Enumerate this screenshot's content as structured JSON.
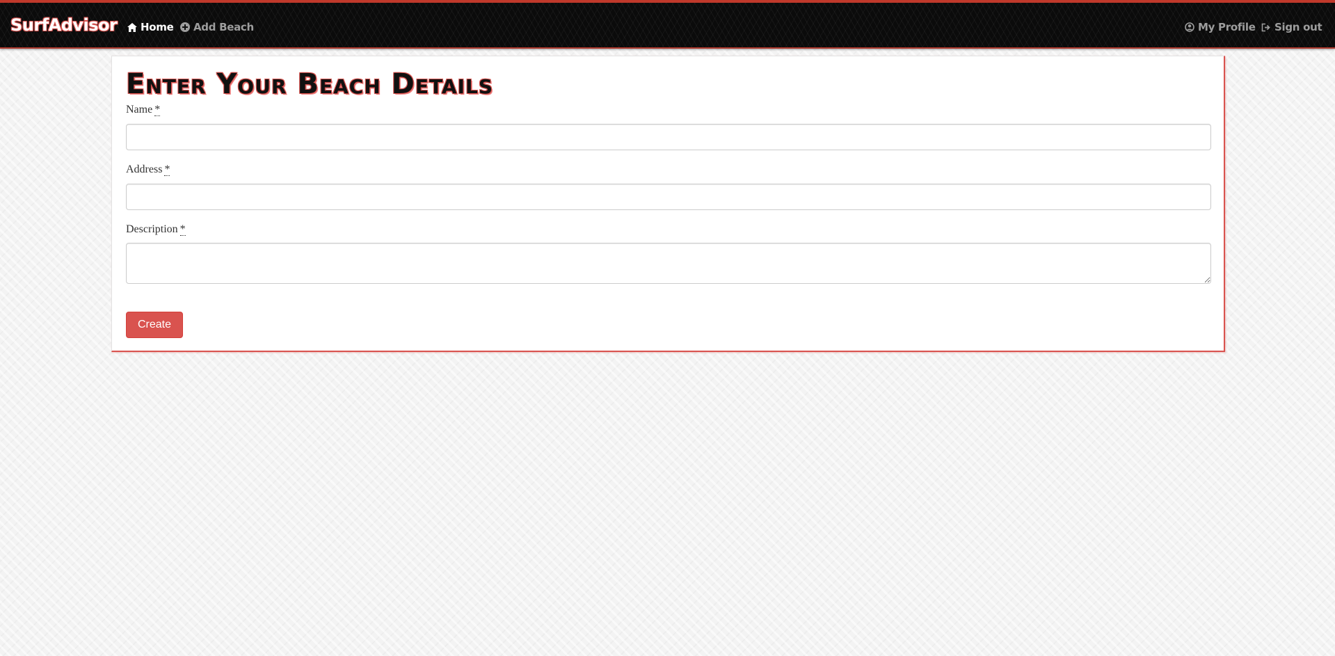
{
  "navbar": {
    "brand": "SurfAdvisor",
    "left_links": [
      {
        "label": "Home",
        "icon": "home-icon",
        "active": true
      },
      {
        "label": "Add Beach",
        "icon": "plus-circle-icon",
        "active": false
      }
    ],
    "right_links": [
      {
        "label": "My Profile",
        "icon": "user-circle-icon"
      },
      {
        "label": "Sign out",
        "icon": "sign-out-icon"
      }
    ]
  },
  "form": {
    "title": "Enter Your Beach Details",
    "fields": {
      "name": {
        "label": "Name",
        "required_mark": "*",
        "value": ""
      },
      "address": {
        "label": "Address",
        "required_mark": "*",
        "value": ""
      },
      "description": {
        "label": "Description",
        "required_mark": "*",
        "value": ""
      }
    },
    "submit_label": "Create"
  },
  "colors": {
    "accent": "#d9534f",
    "navbar_bg": "#0b0b0b",
    "nav_muted": "#9d9d9d"
  }
}
